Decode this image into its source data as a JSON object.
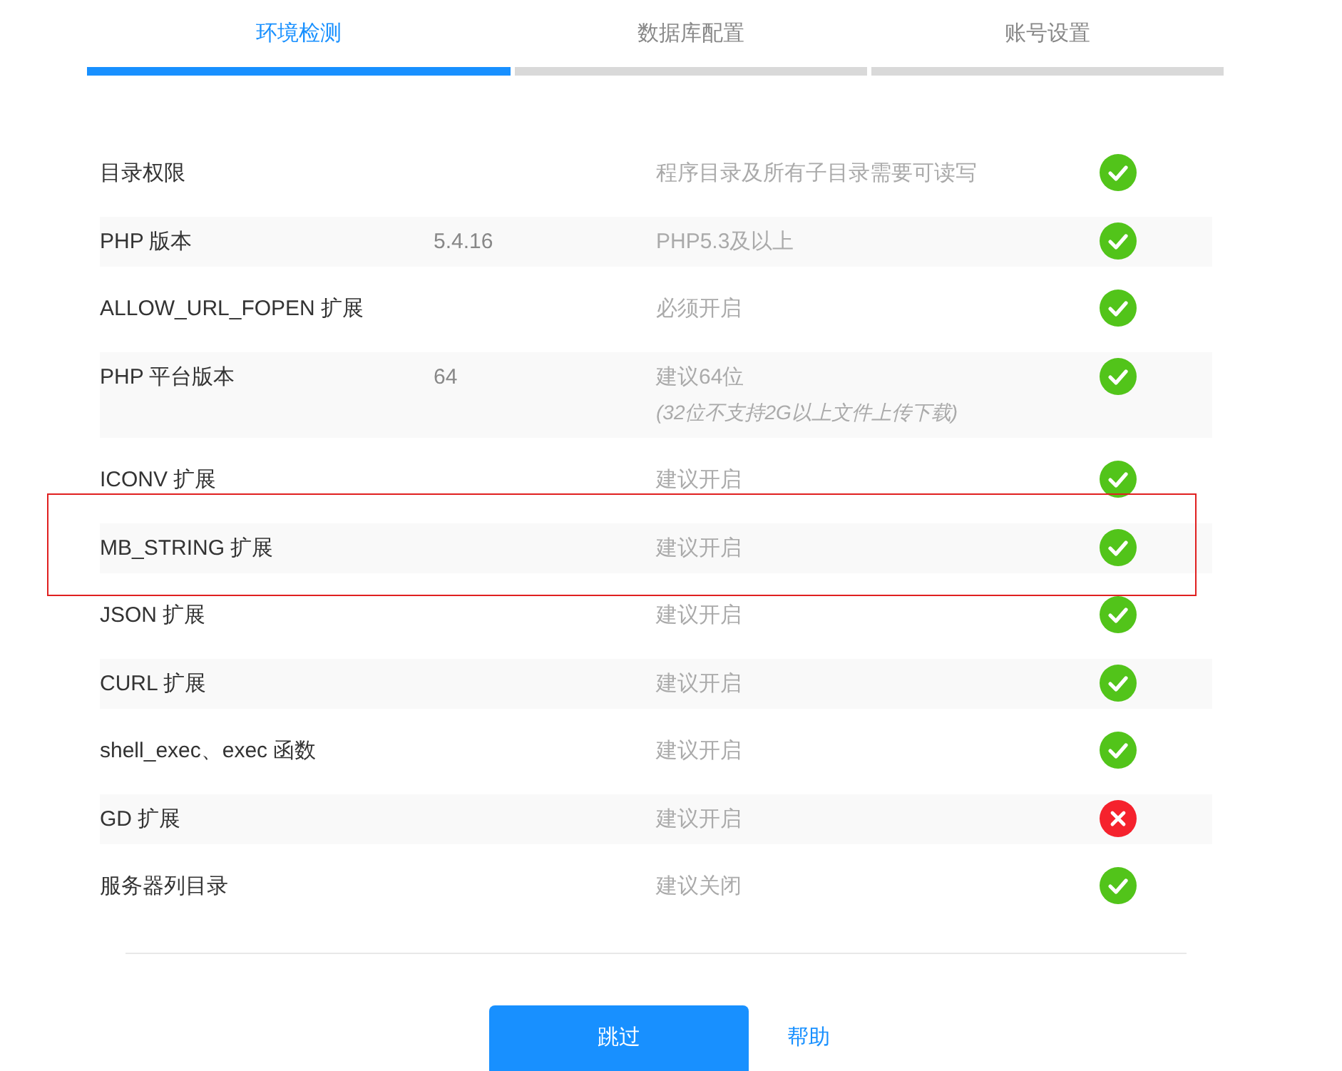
{
  "tabs": [
    {
      "label": "环境检测",
      "selected": true
    },
    {
      "label": "数据库配置",
      "selected": false
    },
    {
      "label": "账号设置",
      "selected": false
    }
  ],
  "checks": [
    {
      "name": "目录权限",
      "requirement": "程序目录及所有子目录需要可读写",
      "passed": true,
      "highlighted": false
    },
    {
      "name": "PHP 版本",
      "value": "5.4.16",
      "requirement": "PHP5.3及以上",
      "passed": true,
      "highlighted": false
    },
    {
      "name": "ALLOW_URL_FOPEN 扩展",
      "requirement": "必须开启",
      "passed": true,
      "highlighted": false
    },
    {
      "name": "PHP 平台版本",
      "value": "64",
      "requirement": "建议64位",
      "note": "(32位不支持2G以上文件上传下载)",
      "passed": true,
      "highlighted": false
    },
    {
      "name": "ICONV 扩展",
      "requirement": "建议开启",
      "passed": true,
      "highlighted": false
    },
    {
      "name": "MB_STRING 扩展",
      "requirement": "建议开启",
      "passed": true,
      "highlighted": true
    },
    {
      "name": "JSON 扩展",
      "requirement": "建议开启",
      "passed": true,
      "highlighted": false
    },
    {
      "name": "CURL 扩展",
      "requirement": "建议开启",
      "passed": true,
      "highlighted": false
    },
    {
      "name": "shell_exec、exec 函数",
      "requirement": "建议开启",
      "passed": true,
      "highlighted": false
    },
    {
      "name": "GD 扩展",
      "requirement": "建议开启",
      "passed": false,
      "highlighted": false
    },
    {
      "name": "服务器列目录",
      "requirement": "建议关闭",
      "passed": true,
      "highlighted": false
    }
  ],
  "buttons": {
    "primary": "跳过",
    "link": "帮助"
  }
}
